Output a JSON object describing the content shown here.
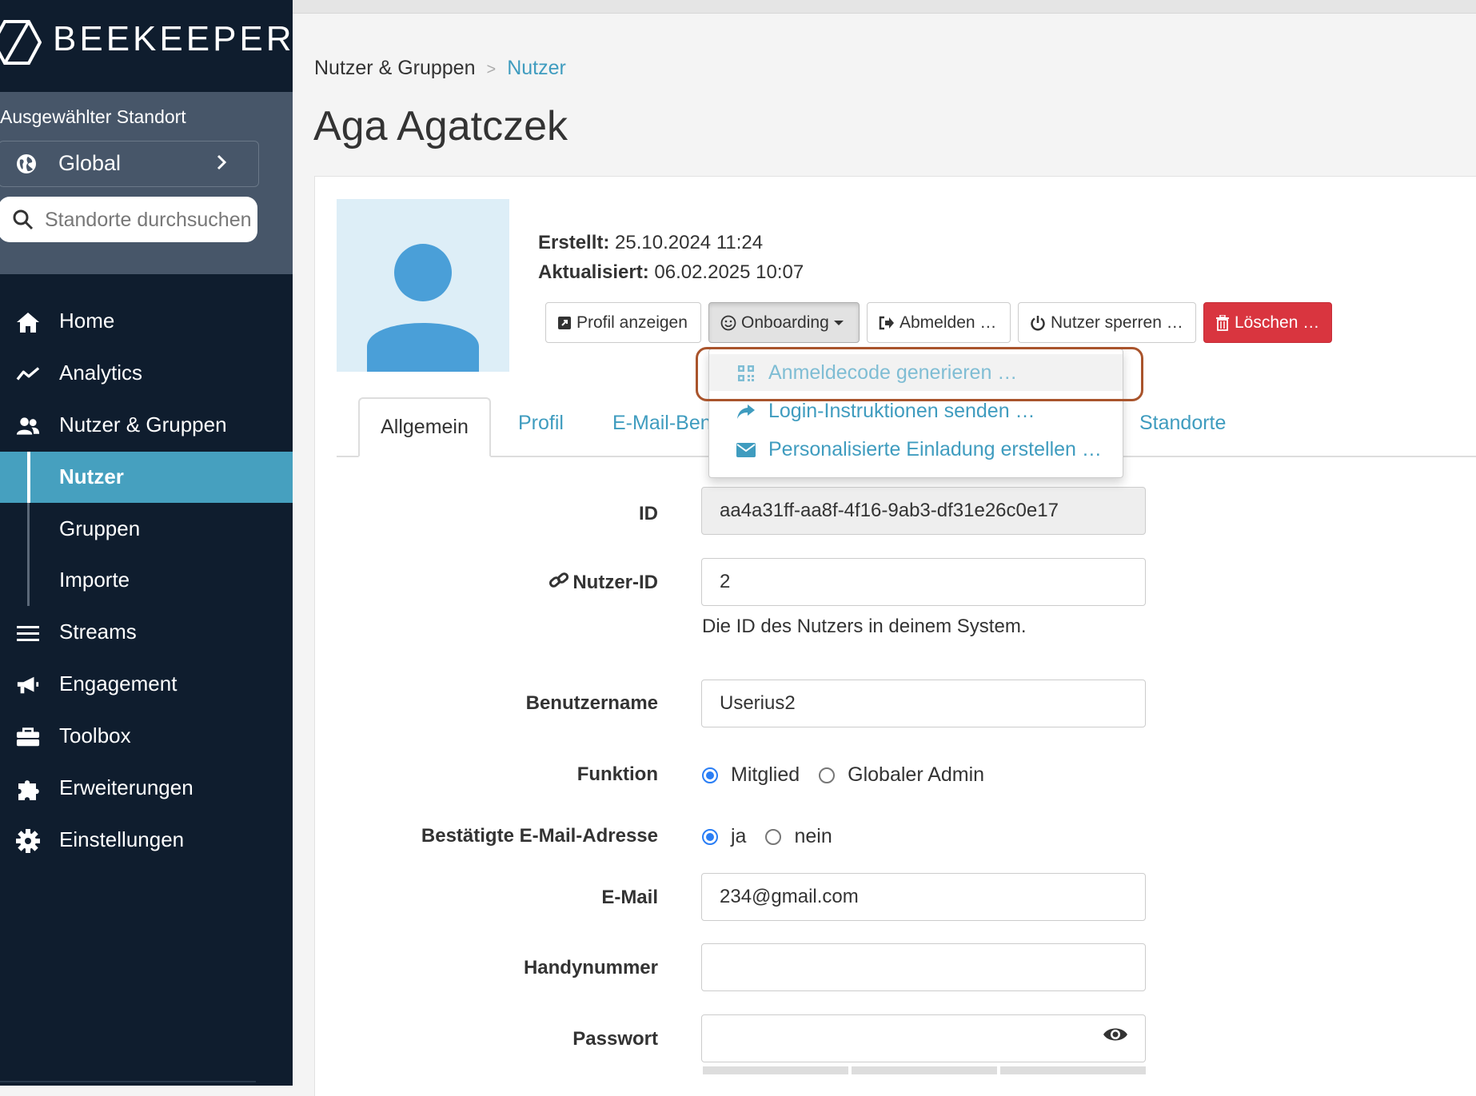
{
  "brand": {
    "name": "BEEKEEPER"
  },
  "sidebar": {
    "site_label": "Ausgewählter Standort",
    "site_value": "Global",
    "search_placeholder": "Standorte durchsuchen",
    "nav": {
      "home": "Home",
      "analytics": "Analytics",
      "users_groups": "Nutzer & Gruppen",
      "users": "Nutzer",
      "groups": "Gruppen",
      "imports": "Importe",
      "streams": "Streams",
      "engagement": "Engagement",
      "toolbox": "Toolbox",
      "extensions": "Erweiterungen",
      "settings": "Einstellungen"
    },
    "active_item": "Nutzer"
  },
  "breadcrumb": {
    "parent": "Nutzer & Gruppen",
    "separator": ">",
    "current": "Nutzer"
  },
  "page": {
    "title": "Aga Agatczek"
  },
  "meta": {
    "created_label": "Erstellt:",
    "created_value": "25.10.2024 11:24",
    "updated_label": "Aktualisiert:",
    "updated_value": "06.02.2025 10:07"
  },
  "actions": {
    "profile": "Profil anzeigen",
    "onboarding": "Onboarding",
    "logout": "Abmelden …",
    "lock": "Nutzer sperren …",
    "delete": "Löschen …"
  },
  "onboarding_menu": {
    "items": [
      {
        "label": "Anmeldecode generieren …",
        "icon": "qr-code-icon"
      },
      {
        "label": "Login-Instruktionen senden …",
        "icon": "share-arrow-icon"
      },
      {
        "label": "Personalisierte Einladung erstellen …",
        "icon": "envelope-icon"
      }
    ]
  },
  "tabs": {
    "general": "Allgemein",
    "profile": "Profil",
    "email": "E-Mail-Bena",
    "sites": "Standorte"
  },
  "form": {
    "id_label": "ID",
    "id_value": "aa4a31ff-aa8f-4f16-9ab3-df31e26c0e17",
    "userid_label": "Nutzer-ID",
    "userid_value": "2",
    "userid_help": "Die ID des Nutzers in deinem System.",
    "username_label": "Benutzername",
    "username_value": "Userius2",
    "role_label": "Funktion",
    "role_member": "Mitglied",
    "role_admin": "Globaler Admin",
    "verified_label": "Bestätigte E-Mail-Adresse",
    "verified_yes": "ja",
    "verified_no": "nein",
    "email_label": "E-Mail",
    "email_value": "234@gmail.com",
    "phone_label": "Handynummer",
    "phone_value": "",
    "password_label": "Passwort",
    "password_value": ""
  },
  "colors": {
    "sidebar": "#0f1d2e",
    "accent": "#46a0bf",
    "link": "#3f9cbf",
    "danger": "#d9353f",
    "highlight": "#a9542c"
  }
}
